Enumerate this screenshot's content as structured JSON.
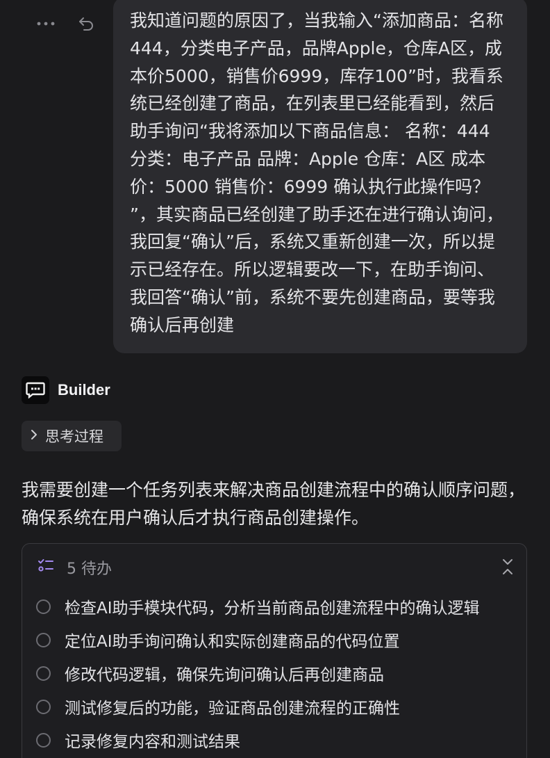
{
  "message_actions": {
    "more_icon": "more-horizontal-icon",
    "undo_icon": "undo-icon"
  },
  "user_message": {
    "text": "我知道问题的原因了，当我输入“添加商品：名称444，分类电子产品，品牌Apple，仓库A区，成本价5000，销售价6999，库存100”时，我看系统已经创建了商品，在列表里已经能看到，然后助手询问“我将添加以下商品信息： 名称：444 分类：电子产品 品牌：Apple 仓库：A区 成本价：5000 销售价：6999 确认执行此操作吗？ ”，其实商品已经创建了助手还在进行确认询问，我回复“确认”后，系统又重新创建一次，所以提示已经存在。所以逻辑要改一下，在助手询问、我回答“确认”前，系统不要先创建商品，要等我确认后再创建"
  },
  "assistant": {
    "name": "Builder",
    "avatar_icon": "chat-bubble-icon",
    "thinking_label": "思考过程",
    "reply": "我需要创建一个任务列表来解决商品创建流程中的确认顺序问题，确保系统在用户确认后才执行商品创建操作。"
  },
  "todo": {
    "icon": "task-list-icon",
    "count_label": "5 待办",
    "accent_color": "#a58bf2",
    "items": [
      {
        "label": "检查AI助手模块代码，分析当前商品创建流程中的确认逻辑"
      },
      {
        "label": "定位AI助手询问确认和实际创建商品的代码位置"
      },
      {
        "label": "修改代码逻辑，确保先询问确认后再创建商品"
      },
      {
        "label": "测试修复后的功能，验证商品创建流程的正确性"
      },
      {
        "label": "记录修复内容和测试结果"
      }
    ]
  }
}
